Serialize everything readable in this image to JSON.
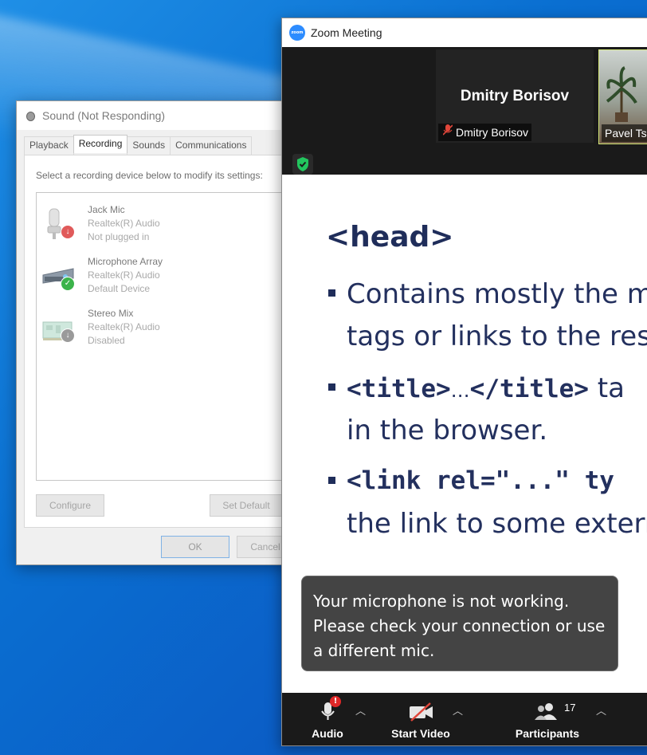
{
  "sound_dialog": {
    "title": "Sound (Not Responding)",
    "tabs": [
      "Playback",
      "Recording",
      "Sounds",
      "Communications"
    ],
    "active_tab": "Recording",
    "hint": "Select a recording device below to modify its settings:",
    "devices": [
      {
        "name": "Jack Mic",
        "driver": "Realtek(R) Audio",
        "status": "Not plugged in"
      },
      {
        "name": "Microphone Array",
        "driver": "Realtek(R) Audio",
        "status": "Default Device"
      },
      {
        "name": "Stereo Mix",
        "driver": "Realtek(R) Audio",
        "status": "Disabled"
      }
    ],
    "configure_label": "Configure",
    "set_default_label": "Set Default",
    "ok_label": "OK",
    "cancel_label": "Cancel"
  },
  "zoom": {
    "title": "Zoom Meeting",
    "logo_text": "zoom",
    "participant_1": "Dmitry Borisov",
    "participant_2": "Pavel Ts",
    "slide": {
      "heading": "<head>",
      "line1": "Contains  mostly  the  m",
      "line2": "tags or links to the reso",
      "line3_code": "<title>",
      "line3_ellipsis": "…",
      "line3_code2": "</title>",
      "line3_rest": " ta",
      "line4": "in the browser.",
      "line5_code": "<link rel=\"...\" ty",
      "line6": "the link to some extern"
    },
    "toast": [
      "Your microphone is not working.",
      "Please check your connection or use",
      "a different mic."
    ],
    "toolbar": {
      "audio_label": "Audio",
      "video_label": "Start Video",
      "participants_label": "Participants",
      "participants_count": "17",
      "audio_alert": "!"
    }
  },
  "colors": {
    "desktop": "#0a6fd1",
    "zoom_blue": "#2d8cff",
    "slide_text": "#1f2d5a",
    "muted_red": "#e0463a"
  }
}
